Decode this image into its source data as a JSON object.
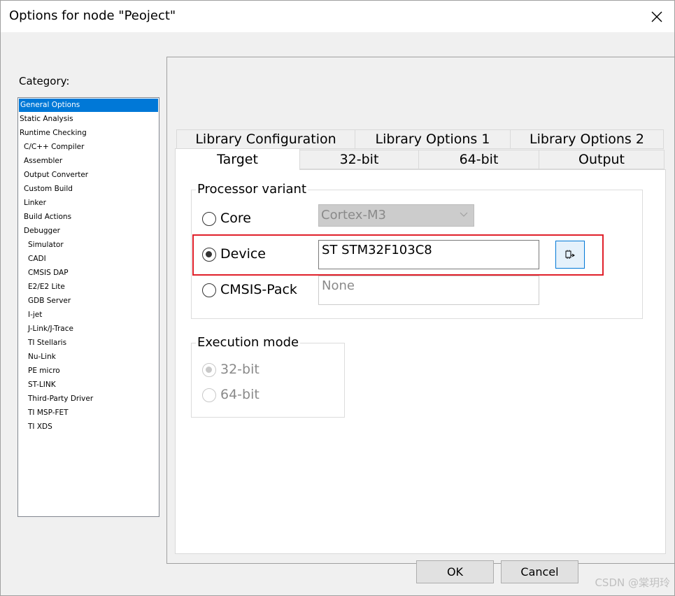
{
  "window": {
    "title": "Options for node \"Peoject\"",
    "close_icon": "close-icon"
  },
  "category": {
    "label": "Category:",
    "items": [
      {
        "label": "General Options",
        "selected": true
      },
      {
        "label": "Static Analysis"
      },
      {
        "label": "Runtime Checking"
      },
      {
        "label": "C/C++ Compiler"
      },
      {
        "label": "Assembler"
      },
      {
        "label": "Output Converter"
      },
      {
        "label": "Custom Build"
      },
      {
        "label": "Linker"
      },
      {
        "label": "Build Actions"
      },
      {
        "label": "Debugger"
      },
      {
        "label": "Simulator"
      },
      {
        "label": "CADI"
      },
      {
        "label": "CMSIS DAP"
      },
      {
        "label": "E2/E2 Lite"
      },
      {
        "label": "GDB Server"
      },
      {
        "label": "I-jet"
      },
      {
        "label": "J-Link/J-Trace"
      },
      {
        "label": "TI Stellaris"
      },
      {
        "label": "Nu-Link"
      },
      {
        "label": "PE micro"
      },
      {
        "label": "ST-LINK"
      },
      {
        "label": "Third-Party Driver"
      },
      {
        "label": "TI MSP-FET"
      },
      {
        "label": "TI XDS"
      }
    ]
  },
  "tabs": {
    "row1": [
      "Library Configuration",
      "Library Options 1",
      "Library Options 2"
    ],
    "row2": [
      "Target",
      "32-bit",
      "64-bit",
      "Output"
    ],
    "active": "Target"
  },
  "processor_variant": {
    "title": "Processor variant",
    "core_label": "Core",
    "core_value": "Cortex-M3",
    "device_label": "Device",
    "device_value": "ST STM32F103C8",
    "cmsis_label": "CMSIS-Pack",
    "cmsis_value": "None",
    "selected": "Device",
    "select_button_icon": "device-select-icon"
  },
  "execution_mode": {
    "title": "Execution mode",
    "option_32": "32-bit",
    "option_64": "64-bit",
    "selected": "32-bit",
    "enabled": false
  },
  "buttons": {
    "ok": "OK",
    "cancel": "Cancel"
  },
  "watermark": "CSDN @棠玥玲",
  "colors": {
    "selection": "#0078d7",
    "highlight": "#e0202a"
  }
}
